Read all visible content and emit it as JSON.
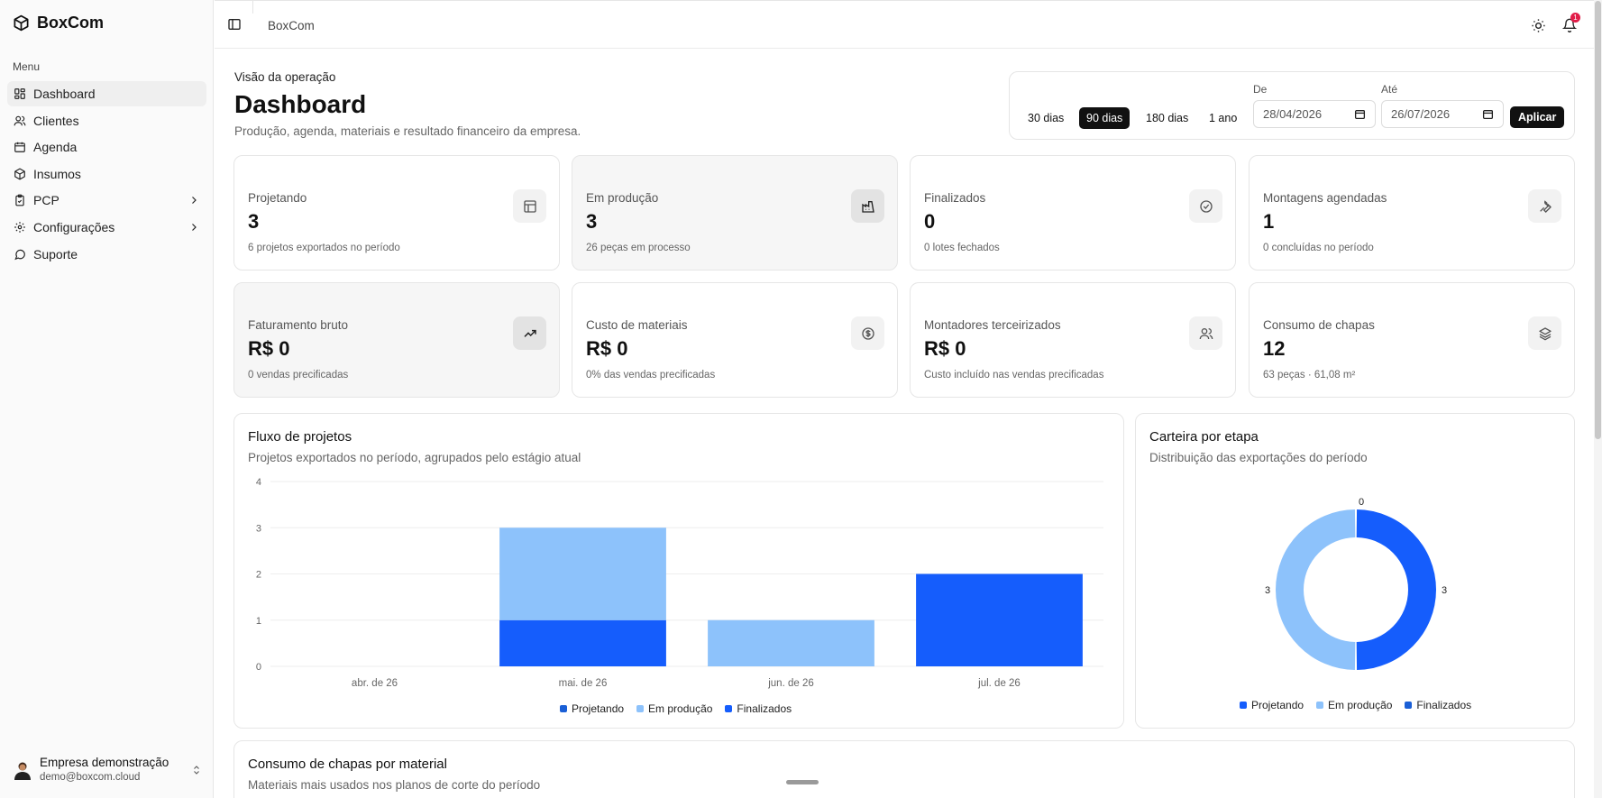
{
  "app": {
    "name": "BoxCom"
  },
  "sidebar": {
    "menu_label": "Menu",
    "items": [
      {
        "label": "Dashboard",
        "icon": "grid-icon",
        "active": true
      },
      {
        "label": "Clientes",
        "icon": "users-icon"
      },
      {
        "label": "Agenda",
        "icon": "calendar-icon"
      },
      {
        "label": "Insumos",
        "icon": "box-icon"
      },
      {
        "label": "PCP",
        "icon": "clipboard-icon",
        "chevron": true
      },
      {
        "label": "Configurações",
        "icon": "gear-icon",
        "chevron": true
      },
      {
        "label": "Suporte",
        "icon": "chat-icon"
      }
    ],
    "user": {
      "name": "Empresa demonstração",
      "email": "demo@boxcom.cloud"
    }
  },
  "topbar": {
    "breadcrumb": "BoxCom",
    "notification_count": "1"
  },
  "header": {
    "eyebrow": "Visão da operação",
    "title": "Dashboard",
    "subtitle": "Produção, agenda, materiais e resultado financeiro da empresa."
  },
  "range": {
    "options": [
      "30 dias",
      "90 dias",
      "180 dias",
      "1 ano"
    ],
    "selected": "90 dias",
    "from_label": "De",
    "from_value": "28/04/2026",
    "to_label": "Até",
    "to_value": "26/07/2026",
    "apply_label": "Aplicar"
  },
  "stats": [
    {
      "label": "Projetando",
      "value": "3",
      "sub": "6 projetos exportados no período",
      "icon": "layout-icon"
    },
    {
      "label": "Em produção",
      "value": "3",
      "sub": "26 peças em processo",
      "icon": "factory-icon"
    },
    {
      "label": "Finalizados",
      "value": "0",
      "sub": "0 lotes fechados",
      "icon": "check-circle-icon"
    },
    {
      "label": "Montagens agendadas",
      "value": "1",
      "sub": "0 concluídas no período",
      "icon": "wrench-icon"
    },
    {
      "label": "Faturamento bruto",
      "value": "R$ 0",
      "sub": "0 vendas precificadas",
      "icon": "trend-up-icon"
    },
    {
      "label": "Custo de materiais",
      "value": "R$ 0",
      "sub": "0% das vendas precificadas",
      "icon": "dollar-circle-icon"
    },
    {
      "label": "Montadores terceirizados",
      "value": "R$ 0",
      "sub": "Custo incluído nas vendas precificadas",
      "icon": "users-icon"
    },
    {
      "label": "Consumo de chapas",
      "value": "12",
      "sub": "63 peças · 61,08 m²",
      "icon": "layers-icon"
    }
  ],
  "flow": {
    "title": "Fluxo de projetos",
    "subtitle": "Projetos exportados no período, agrupados pelo estágio atual"
  },
  "carteira": {
    "title": "Carteira por etapa",
    "subtitle": "Distribuição das exportações do período"
  },
  "consumo": {
    "title": "Consumo de chapas por material",
    "subtitle": "Materiais mais usados nos planos de corte do período"
  },
  "chart_data": [
    {
      "type": "bar",
      "stacked": true,
      "categories": [
        "abr. de 26",
        "mai. de 26",
        "jun. de 26",
        "jul. de 26"
      ],
      "series": [
        {
          "name": "Projetando",
          "values": [
            0,
            0,
            0,
            0
          ],
          "color": "#1a5fd6"
        },
        {
          "name": "Em produção",
          "values": [
            0,
            2,
            1,
            0
          ],
          "color": "#8dc2fb"
        },
        {
          "name": "Finalizados",
          "values": [
            0,
            1,
            0,
            2
          ],
          "color": "#155dfc"
        }
      ],
      "ylim": [
        0,
        4
      ],
      "yticks": [
        0,
        1,
        2,
        3,
        4
      ],
      "grid": true,
      "legend": "bottom"
    },
    {
      "type": "pie",
      "donut": true,
      "categories": [
        "Projetando",
        "Em produção",
        "Finalizados"
      ],
      "values": [
        3,
        3,
        0
      ],
      "labels": [
        "3",
        "3",
        "0"
      ],
      "colors": [
        "#155dfc",
        "#8dc2fb",
        "#1a5fd6"
      ],
      "legend": "bottom"
    }
  ]
}
